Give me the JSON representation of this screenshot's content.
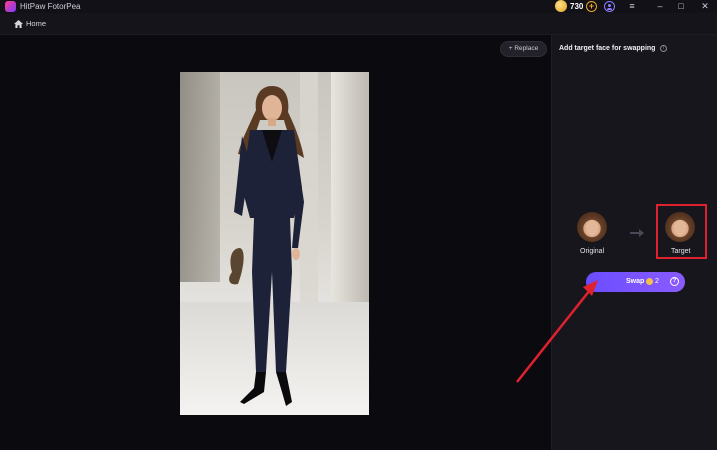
{
  "window": {
    "title": "HitPaw FotorPea",
    "coins": "730",
    "add_symbol": "+",
    "menu_symbol": "≡",
    "min_symbol": "–",
    "max_symbol": "□",
    "close_symbol": "✕"
  },
  "nav": {
    "home_label": "Home"
  },
  "canvas": {
    "replace_label": "+ Replace"
  },
  "panel": {
    "title": "Add target face for swapping",
    "info_symbol": "i",
    "original_label": "Original",
    "target_label": "Target",
    "swap_label": "Swap",
    "swap_cost": "2",
    "help_symbol": "?"
  },
  "colors": {
    "accent": "#7a55ff",
    "highlight": "#e0222f",
    "coin": "#f0a62a"
  },
  "icons": [
    "app-logo-icon",
    "coin-icon",
    "add-coin-icon",
    "user-icon",
    "menu-icon",
    "home-icon",
    "info-icon",
    "arrow-right-icon",
    "help-icon"
  ]
}
